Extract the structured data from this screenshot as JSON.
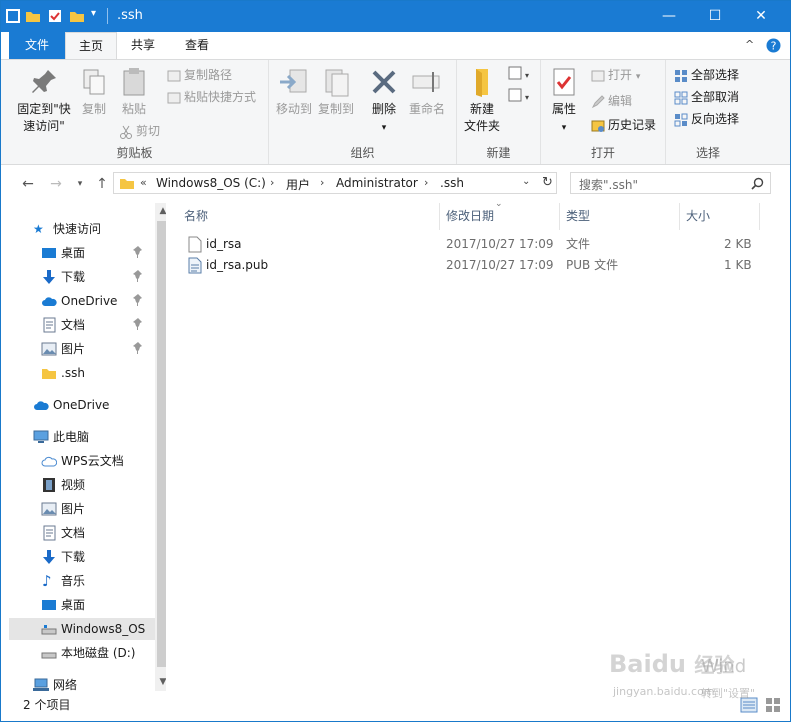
{
  "window": {
    "title": ".ssh",
    "controls": {
      "minimize": "minimize-icon",
      "maximize": "maximize-icon",
      "close": "close-icon"
    }
  },
  "ribbon_tabs": [
    "文件",
    "主页",
    "共享",
    "查看"
  ],
  "ribbon": {
    "clipboard": {
      "label": "剪贴板",
      "pin": "固定到\"快",
      "pin2": "速访问\"",
      "copy": "复制",
      "paste": "粘贴",
      "copy_path": "复制路径",
      "paste_shortcut": "粘贴快捷方式",
      "cut": "剪切"
    },
    "organize": {
      "label": "组织",
      "move_to": "移动到",
      "copy_to": "复制到",
      "delete": "删除",
      "rename": "重命名"
    },
    "new": {
      "label": "新建",
      "new_folder": "新建",
      "new_folder2": "文件夹"
    },
    "open": {
      "label": "打开",
      "properties": "属性",
      "open": "打开",
      "edit": "编辑",
      "history": "历史记录"
    },
    "select": {
      "label": "选择",
      "select_all": "全部选择",
      "select_none": "全部取消",
      "invert": "反向选择"
    }
  },
  "address": {
    "prefix": "«",
    "crumbs": [
      "Windows8_OS (C:)",
      "用户",
      "Administrator",
      ".ssh"
    ],
    "search_placeholder": "搜索\".ssh\""
  },
  "nav": {
    "quick_access": "快速访问",
    "quick_items": [
      "桌面",
      "下载",
      "OneDrive",
      "文档",
      "图片",
      ".ssh"
    ],
    "onedrive": "OneDrive",
    "this_pc": "此电脑",
    "pc_items": [
      "WPS云文档",
      "视频",
      "图片",
      "文档",
      "下载",
      "音乐",
      "桌面",
      "Windows8_OS",
      "本地磁盘 (D:)"
    ],
    "network": "网络"
  },
  "columns": [
    "名称",
    "修改日期",
    "类型",
    "大小"
  ],
  "files": [
    {
      "name": "id_rsa",
      "date": "2017/10/27 17:09",
      "type": "文件",
      "size": "2 KB"
    },
    {
      "name": "id_rsa.pub",
      "date": "2017/10/27 17:09",
      "type": "PUB 文件",
      "size": "1 KB"
    }
  ],
  "status": {
    "count": "2 个项目"
  },
  "watermark": {
    "brand": "Baidu",
    "brand_cn": "经验",
    "win": "Wind",
    "url": "jingyan.baidu.com",
    "hint": "转到\"设置\""
  },
  "colors": {
    "accent": "#1a7bd3",
    "folder": "#f5c542"
  }
}
